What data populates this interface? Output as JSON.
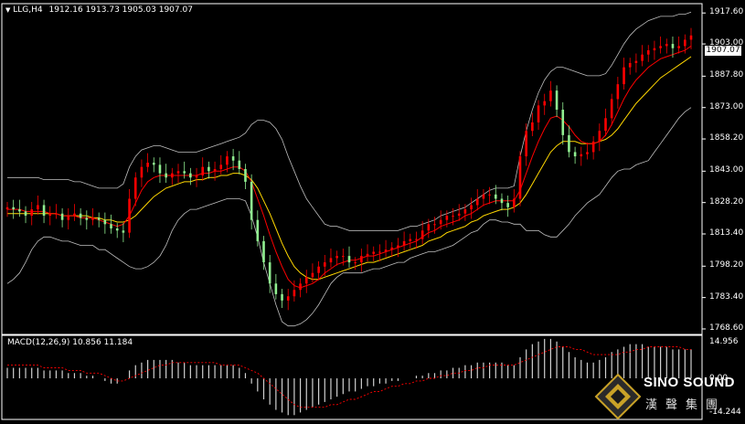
{
  "header": {
    "symbol": "LLG,H4",
    "ohlc": "1912.16 1913.73 1905.03 1907.07"
  },
  "price_axis": {
    "ticks": [
      "1917.60",
      "1903.00",
      "1887.80",
      "1873.00",
      "1858.20",
      "1843.00",
      "1828.20",
      "1813.40",
      "1798.20",
      "1783.40",
      "1768.60"
    ],
    "current_price": "1907.07"
  },
  "macd": {
    "label": "MACD(12,26,9) 10.856 11.184",
    "ticks": [
      "14.956",
      "0.00",
      "-14.244"
    ]
  },
  "logo": {
    "name": "SINO SOUND",
    "subtitle": "漢聲集團"
  },
  "colors": {
    "background": "#000000",
    "bull_candle": "#ff0000",
    "bear_candle": "#90ee90",
    "ma_fast": "#ff0000",
    "ma_slow": "#ffd700",
    "bands": "#c0c0c0",
    "macd_hist": "#d0d0d0",
    "macd_signal": "#ff0000"
  },
  "chart_data": {
    "type": "candlestick",
    "ylim": [
      1766,
      1922
    ],
    "close": [
      1826,
      1825,
      1824,
      1822,
      1825,
      1827,
      1822,
      1823,
      1823,
      1820,
      1822,
      1823,
      1821,
      1820,
      1821,
      1820,
      1818,
      1816,
      1815,
      1814,
      1830,
      1840,
      1845,
      1847,
      1846,
      1842,
      1840,
      1842,
      1843,
      1842,
      1840,
      1841,
      1845,
      1843,
      1844,
      1846,
      1850,
      1848,
      1844,
      1838,
      1820,
      1810,
      1800,
      1790,
      1785,
      1782,
      1784,
      1787,
      1790,
      1793,
      1795,
      1798,
      1800,
      1802,
      1803,
      1803,
      1800,
      1800,
      1803,
      1804,
      1805,
      1805,
      1806,
      1807,
      1808,
      1810,
      1811,
      1811,
      1815,
      1818,
      1818,
      1820,
      1822,
      1822,
      1823,
      1825,
      1827,
      1830,
      1832,
      1832,
      1830,
      1828,
      1826,
      1830,
      1850,
      1862,
      1866,
      1874,
      1876,
      1881,
      1872,
      1860,
      1852,
      1850,
      1851,
      1852,
      1857,
      1862,
      1868,
      1877,
      1884,
      1892,
      1894,
      1895,
      1898,
      1900,
      1901,
      1902,
      1903,
      1901,
      1902,
      1905,
      1907
    ],
    "bb_upper": [
      1840,
      1840,
      1840,
      1840,
      1840,
      1840,
      1839,
      1839,
      1839,
      1839,
      1839,
      1838,
      1838,
      1837,
      1836,
      1835,
      1835,
      1835,
      1835,
      1837,
      1845,
      1850,
      1853,
      1854,
      1855,
      1855,
      1854,
      1853,
      1852,
      1852,
      1852,
      1852,
      1853,
      1854,
      1855,
      1856,
      1857,
      1858,
      1859,
      1861,
      1865,
      1867,
      1867,
      1866,
      1863,
      1858,
      1850,
      1843,
      1836,
      1830,
      1826,
      1822,
      1818,
      1817,
      1817,
      1816,
      1815,
      1815,
      1815,
      1815,
      1815,
      1815,
      1815,
      1815,
      1815,
      1816,
      1817,
      1817,
      1818,
      1819,
      1820,
      1822,
      1823,
      1824,
      1825,
      1826,
      1828,
      1830,
      1832,
      1834,
      1835,
      1835,
      1835,
      1836,
      1850,
      1862,
      1872,
      1880,
      1886,
      1890,
      1892,
      1892,
      1891,
      1890,
      1889,
      1888,
      1888,
      1888,
      1889,
      1893,
      1898,
      1903,
      1907,
      1910,
      1912,
      1914,
      1915,
      1916,
      1916,
      1916,
      1917,
      1917,
      1918
    ],
    "bb_lower": [
      1790,
      1792,
      1795,
      1800,
      1806,
      1810,
      1812,
      1812,
      1811,
      1810,
      1810,
      1809,
      1808,
      1808,
      1808,
      1806,
      1806,
      1804,
      1802,
      1800,
      1798,
      1797,
      1797,
      1798,
      1800,
      1803,
      1808,
      1815,
      1820,
      1823,
      1825,
      1825,
      1826,
      1827,
      1828,
      1829,
      1830,
      1830,
      1830,
      1829,
      1822,
      1812,
      1800,
      1790,
      1780,
      1772,
      1770,
      1770,
      1771,
      1773,
      1776,
      1780,
      1785,
      1790,
      1793,
      1795,
      1795,
      1795,
      1795,
      1796,
      1797,
      1797,
      1798,
      1799,
      1800,
      1800,
      1802,
      1803,
      1804,
      1805,
      1805,
      1806,
      1807,
      1808,
      1810,
      1812,
      1814,
      1815,
      1818,
      1820,
      1820,
      1819,
      1819,
      1818,
      1818,
      1815,
      1815,
      1815,
      1813,
      1812,
      1812,
      1815,
      1818,
      1822,
      1825,
      1828,
      1830,
      1832,
      1836,
      1840,
      1843,
      1844,
      1844,
      1846,
      1847,
      1848,
      1852,
      1856,
      1860,
      1864,
      1868,
      1871,
      1873
    ],
    "ma_fast": [
      1825,
      1825,
      1825,
      1824,
      1824,
      1824,
      1824,
      1823,
      1823,
      1822,
      1822,
      1822,
      1821,
      1821,
      1821,
      1820,
      1819,
      1818,
      1817,
      1818,
      1822,
      1828,
      1834,
      1838,
      1840,
      1841,
      1841,
      1841,
      1841,
      1841,
      1841,
      1841,
      1842,
      1842,
      1843,
      1843,
      1844,
      1845,
      1845,
      1843,
      1838,
      1830,
      1822,
      1813,
      1805,
      1798,
      1792,
      1789,
      1788,
      1789,
      1790,
      1792,
      1795,
      1797,
      1799,
      1800,
      1801,
      1801,
      1802,
      1803,
      1803,
      1804,
      1805,
      1806,
      1807,
      1808,
      1809,
      1810,
      1812,
      1814,
      1815,
      1817,
      1818,
      1819,
      1820,
      1822,
      1823,
      1825,
      1827,
      1828,
      1829,
      1829,
      1829,
      1829,
      1834,
      1842,
      1850,
      1857,
      1863,
      1868,
      1869,
      1867,
      1864,
      1860,
      1857,
      1856,
      1856,
      1857,
      1860,
      1865,
      1871,
      1877,
      1882,
      1886,
      1889,
      1892,
      1894,
      1896,
      1897,
      1898,
      1899,
      1900,
      1902
    ],
    "ma_slow": [
      1823,
      1823,
      1823,
      1823,
      1823,
      1823,
      1823,
      1823,
      1823,
      1822,
      1822,
      1822,
      1822,
      1822,
      1821,
      1821,
      1820,
      1820,
      1819,
      1819,
      1820,
      1822,
      1825,
      1828,
      1831,
      1833,
      1835,
      1836,
      1837,
      1838,
      1838,
      1839,
      1839,
      1840,
      1840,
      1841,
      1841,
      1842,
      1842,
      1841,
      1839,
      1835,
      1829,
      1823,
      1816,
      1809,
      1803,
      1798,
      1795,
      1793,
      1792,
      1792,
      1793,
      1794,
      1795,
      1796,
      1797,
      1798,
      1799,
      1800,
      1800,
      1801,
      1802,
      1803,
      1804,
      1805,
      1806,
      1807,
      1808,
      1810,
      1811,
      1812,
      1814,
      1815,
      1816,
      1817,
      1819,
      1820,
      1822,
      1823,
      1824,
      1825,
      1825,
      1826,
      1828,
      1832,
      1837,
      1842,
      1847,
      1852,
      1855,
      1857,
      1857,
      1857,
      1856,
      1856,
      1856,
      1857,
      1858,
      1860,
      1863,
      1867,
      1871,
      1875,
      1878,
      1881,
      1884,
      1887,
      1889,
      1891,
      1893,
      1895,
      1897
    ],
    "macd_hist": [
      4,
      4,
      4,
      4,
      4,
      4,
      3,
      3,
      3,
      3,
      2,
      2,
      2,
      1,
      1,
      0,
      -1,
      -2,
      -2,
      0,
      3,
      5,
      6,
      7,
      7,
      7,
      7,
      7,
      6,
      6,
      5,
      5,
      5,
      5,
      5,
      5,
      5,
      5,
      4,
      2,
      -2,
      -5,
      -8,
      -10,
      -12,
      -13,
      -14,
      -14,
      -13,
      -12,
      -11,
      -10,
      -9,
      -8,
      -7,
      -6,
      -5,
      -5,
      -4,
      -3,
      -3,
      -2,
      -2,
      -1,
      -1,
      0,
      0,
      1,
      1,
      2,
      2,
      3,
      3,
      4,
      4,
      5,
      5,
      6,
      6,
      6,
      6,
      6,
      5,
      5,
      8,
      11,
      13,
      14,
      15,
      15,
      14,
      12,
      10,
      8,
      7,
      6,
      6,
      7,
      8,
      10,
      11,
      12,
      13,
      13,
      13,
      12,
      12,
      12,
      12,
      11,
      11,
      11,
      11
    ],
    "macd_signal": [
      5,
      5,
      5,
      5,
      5,
      5,
      4,
      4,
      4,
      4,
      3,
      3,
      3,
      2,
      2,
      2,
      1,
      0,
      -1,
      -1,
      0,
      1,
      2,
      3,
      4,
      5,
      5,
      6,
      6,
      6,
      6,
      6,
      6,
      6,
      6,
      5,
      5,
      5,
      5,
      4,
      3,
      2,
      0,
      -2,
      -4,
      -6,
      -8,
      -10,
      -11,
      -11,
      -11,
      -11,
      -11,
      -10,
      -10,
      -9,
      -8,
      -8,
      -7,
      -6,
      -5,
      -5,
      -4,
      -3,
      -3,
      -2,
      -2,
      -1,
      -1,
      0,
      0,
      1,
      1,
      2,
      2,
      3,
      3,
      4,
      4,
      5,
      5,
      5,
      5,
      5,
      6,
      7,
      8,
      9,
      10,
      11,
      12,
      12,
      12,
      11,
      11,
      10,
      9,
      9,
      9,
      9,
      9,
      10,
      10,
      11,
      11,
      12,
      12,
      12,
      12,
      12,
      12,
      11,
      11
    ]
  }
}
